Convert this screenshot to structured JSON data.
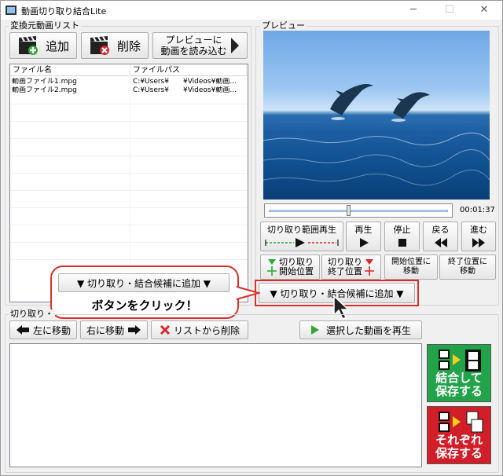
{
  "window": {
    "title": "動画切り取り結合Lite",
    "minimize": "─",
    "maximize": "☐",
    "close": "✕"
  },
  "source_group": {
    "label": "変換元動画リスト",
    "add_button": "追加",
    "delete_button": "削除",
    "preview_button": "プレビューに\n動画を読み込む",
    "columns": [
      "ファイル名",
      "ファイルパス"
    ],
    "rows": [
      {
        "name": "動画ファイル1.mpg",
        "path": "C:¥Users¥　　¥Videos¥動画..."
      },
      {
        "name": "動画ファイル2.mpg",
        "path": "C:¥Users¥　　¥Videos¥動画..."
      }
    ]
  },
  "preview_group": {
    "label": "プレビュー",
    "time": "00:01:37",
    "buttons": {
      "range_play": "切り取り範囲再生",
      "play": "再生",
      "stop": "停止",
      "back": "戻る",
      "forward": "進む",
      "set_start": "切り取り\n開始位置",
      "set_end": "切り取り\n終了位置",
      "move_start": "開始位置に\n移動",
      "move_end": "終了位置に\n移動",
      "add_candidate": "▼ 切り取り・結合候補に追加 ▼"
    }
  },
  "callout": {
    "button_label": "▼ 切り取り・結合候補に追加 ▼",
    "instruction": "ボタンをクリック！"
  },
  "bottom_group": {
    "label": "切り取り・",
    "move_left": "左に移動",
    "move_right": "右に移動",
    "remove": "リストから削除",
    "play_selected": "選択した動画を再生",
    "combine_save": "結合して\n保存する",
    "separate_save": "それぞれ\n保存する"
  },
  "colors": {
    "accent_red": "#d9302c",
    "green_button": "#22a34a",
    "red_button": "#d21e28"
  },
  "icons": [
    "clapper-add-icon",
    "clapper-delete-icon",
    "play-triangle-icon",
    "arrow-left-icon",
    "arrow-right-icon",
    "red-x-icon",
    "green-play-icon",
    "film-combine-icon",
    "film-separate-icon",
    "cursor-arrow-icon"
  ]
}
